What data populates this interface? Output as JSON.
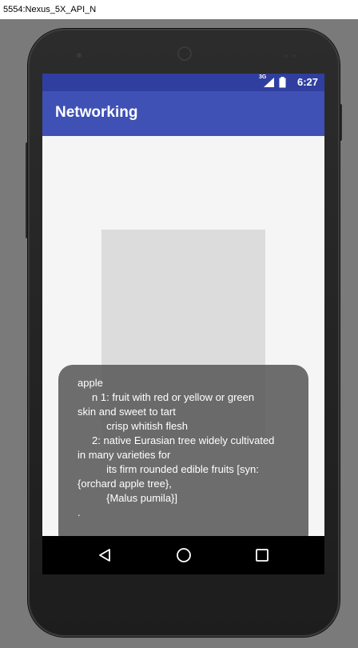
{
  "window": {
    "title": "5554:Nexus_5X_API_N"
  },
  "status_bar": {
    "time": "6:27",
    "network_label": "3G"
  },
  "app_bar": {
    "title": "Networking"
  },
  "toast": {
    "text": "apple\n     n 1: fruit with red or yellow or green\nskin and sweet to tart\n          crisp whitish flesh\n     2: native Eurasian tree widely cultivated\nin many varieties for\n          its firm rounded edible fruits [syn:\n{orchard apple tree},\n          {Malus pumila}]\n."
  },
  "nav_bar": {
    "back_icon": "back-triangle-icon",
    "home_icon": "home-circle-icon",
    "recents_icon": "recents-square-icon"
  },
  "colors": {
    "status_bar": "#303f9f",
    "app_bar": "#3f51b5",
    "toast_bg": "#5a5a5a"
  }
}
